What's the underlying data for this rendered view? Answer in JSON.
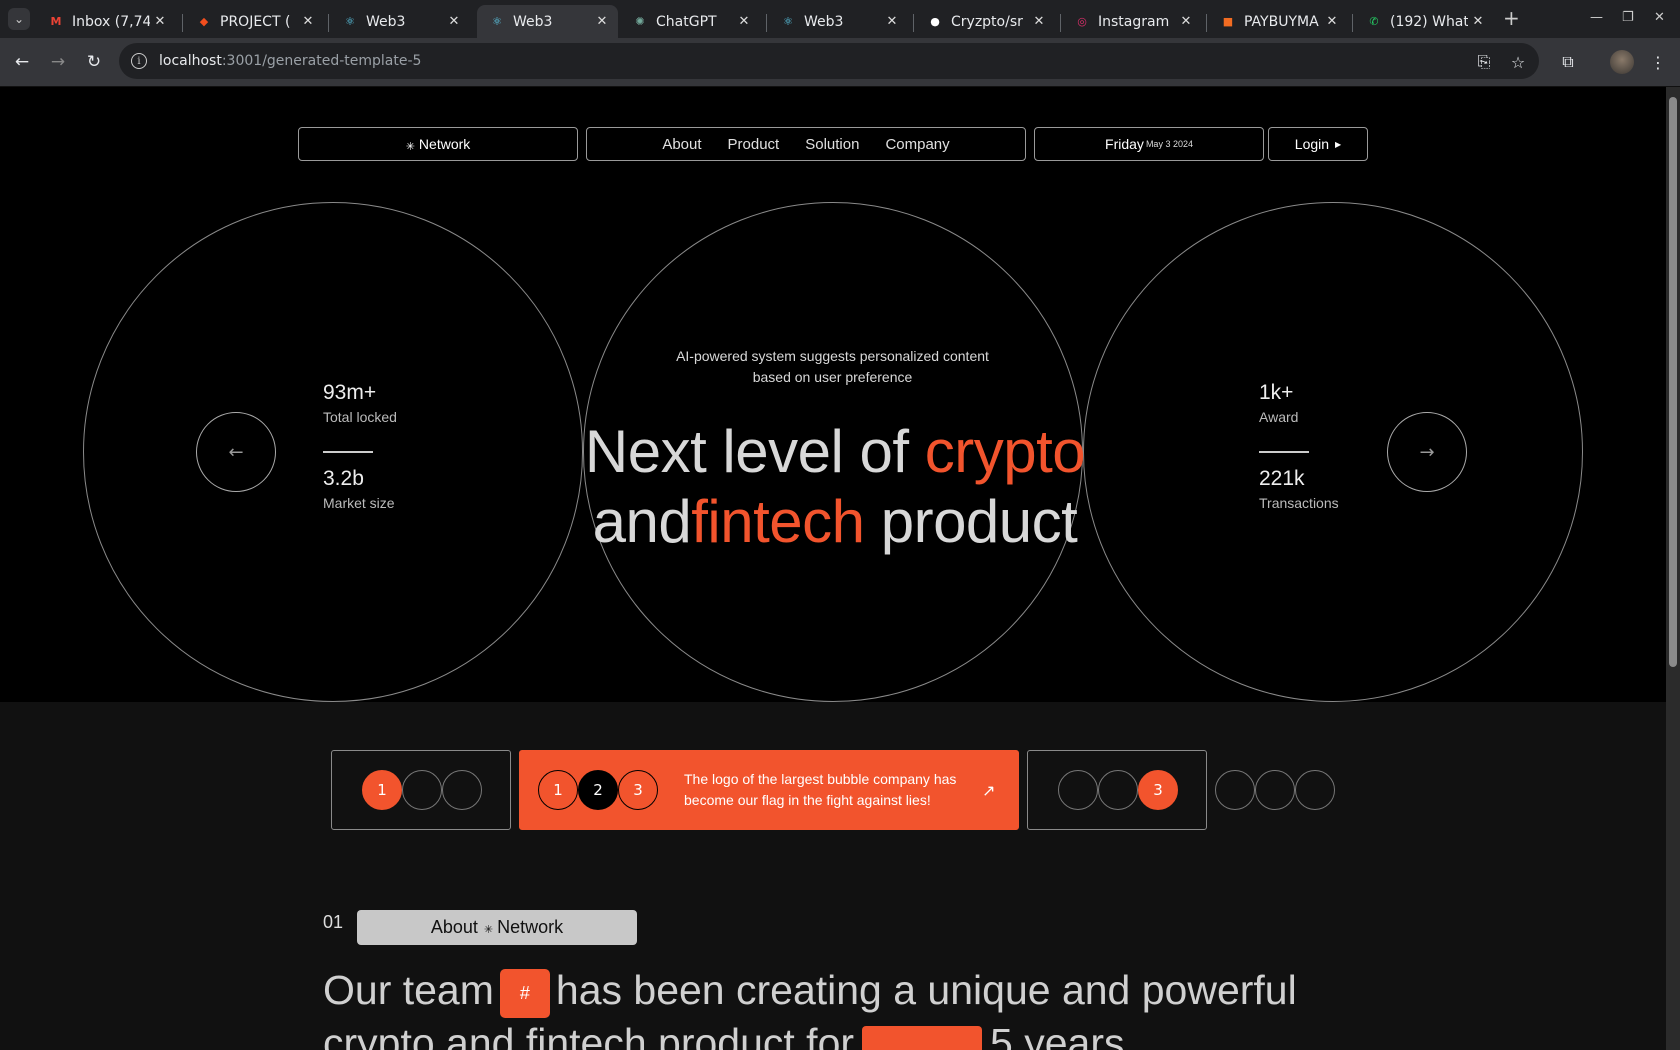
{
  "browser": {
    "tabs": [
      {
        "title": "Inbox (7,74",
        "favicon": "gmail-icon",
        "color": "#ea4335"
      },
      {
        "title": "PROJECT (",
        "favicon": "figma-icon",
        "color": "#f24e1e"
      },
      {
        "title": "Web3",
        "favicon": "react-icon",
        "color": "#61dafb"
      },
      {
        "title": "Web3",
        "favicon": "react-icon",
        "color": "#61dafb",
        "active": true
      },
      {
        "title": "ChatGPT",
        "favicon": "chatgpt-icon",
        "color": "#74aa9c"
      },
      {
        "title": "Web3",
        "favicon": "react-icon",
        "color": "#61dafb"
      },
      {
        "title": "Cryzpto/sr",
        "favicon": "github-icon",
        "color": "#ffffff"
      },
      {
        "title": "Instagram",
        "favicon": "instagram-icon",
        "color": "#e1306c"
      },
      {
        "title": "PAYBUYMA",
        "favicon": "paybuy-icon",
        "color": "#f26c22"
      },
      {
        "title": "(192) What",
        "favicon": "whatsapp-icon",
        "color": "#25d366"
      }
    ],
    "url_host": "localhost",
    "url_path": ":3001/generated-template-5"
  },
  "nav": {
    "brand": "Network",
    "links": [
      "About",
      "Product",
      "Solution",
      "Company"
    ],
    "day": "Friday",
    "date": "May 3 2024",
    "login": "Login"
  },
  "hero": {
    "subtitle": "AI-powered system suggests personalized content based on user preference",
    "headline_1": "Next level of ",
    "headline_1_accent": "crypto",
    "headline_2": "and",
    "headline_2_accent": "fintech",
    "headline_2_end": " product",
    "left_stats": [
      {
        "value": "93m+",
        "label": "Total locked"
      },
      {
        "value": "3.2b",
        "label": "Market size"
      }
    ],
    "right_stats": [
      {
        "value": "1k+",
        "label": "Award"
      },
      {
        "value": "221k",
        "label": "Transactions"
      }
    ],
    "prev_arrow": "←",
    "next_arrow": "→"
  },
  "cards": {
    "card1_active": "1",
    "card2_dots": [
      "1",
      "2",
      "3"
    ],
    "card2_text": "The logo of the largest bubble company has become our flag in the fight against lies!",
    "card2_arrow": "↗",
    "card3_active": "3"
  },
  "about": {
    "number": "01",
    "pill_label": "About",
    "pill_brand": "Network",
    "text_1": "Our team",
    "hash": "#",
    "text_2": "has been creating a unique and powerful",
    "text_3": "crypto and fintech product for",
    "text_4": "5 years"
  },
  "colors": {
    "accent": "#f2542d",
    "bg_dark": "#000000",
    "bg_section": "#111111"
  }
}
